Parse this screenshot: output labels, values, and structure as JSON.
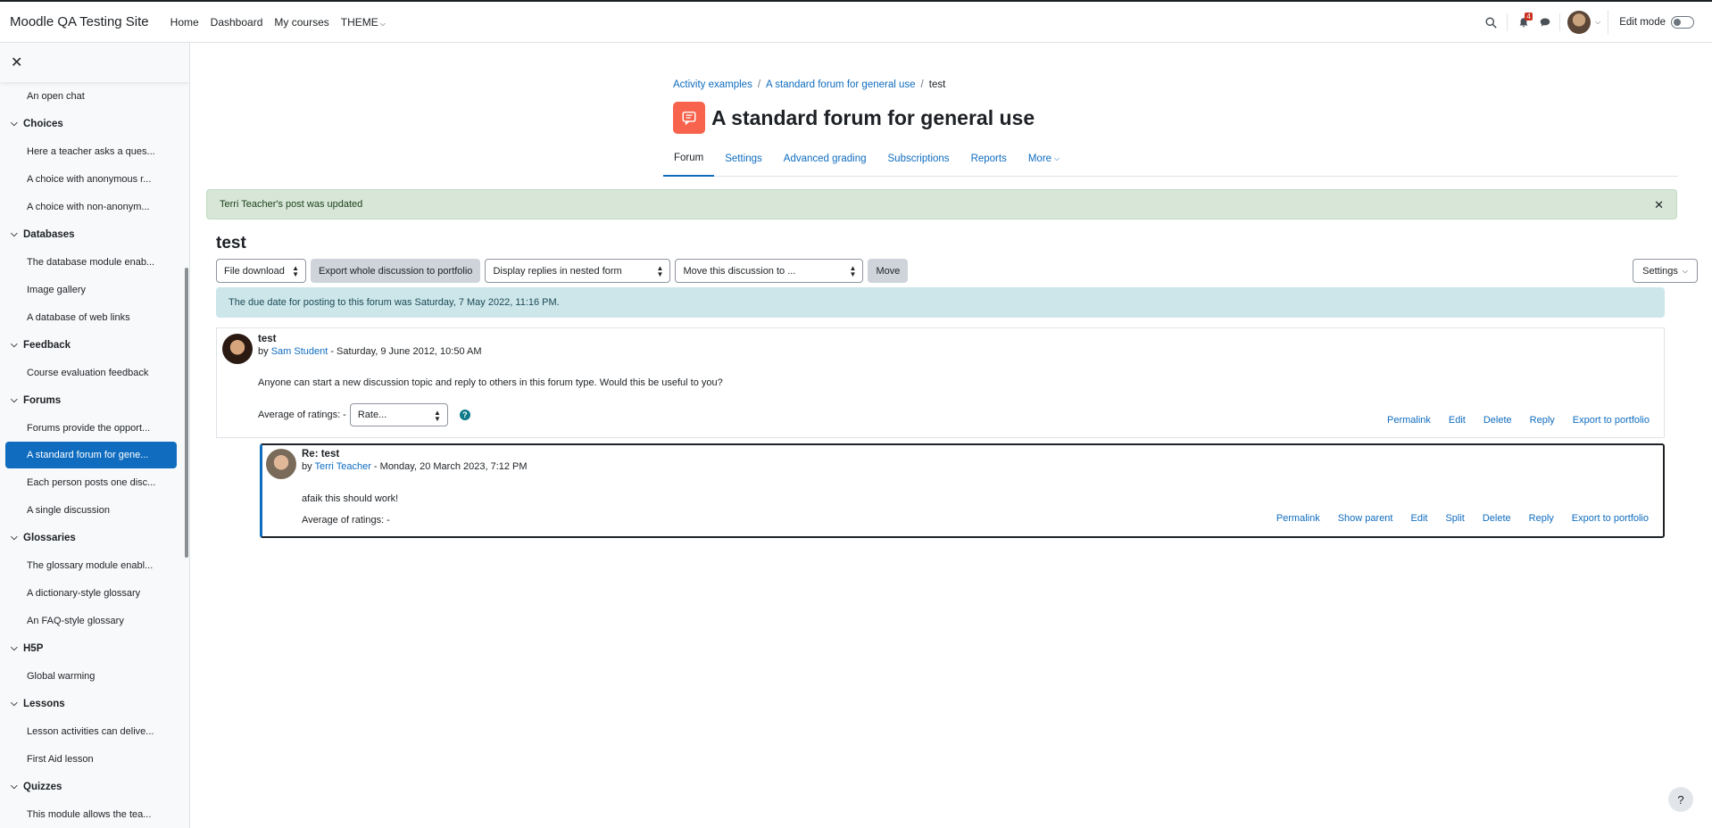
{
  "navbar": {
    "site_name": "Moodle QA Testing Site",
    "links": [
      "Home",
      "Dashboard",
      "My courses",
      "THEME"
    ],
    "notification_count": "4",
    "edit_mode_label": "Edit mode"
  },
  "drawer": {
    "items": [
      {
        "type": "item",
        "label": "An open chat"
      },
      {
        "type": "section",
        "label": "Choices"
      },
      {
        "type": "item",
        "label": "Here a teacher asks a ques..."
      },
      {
        "type": "item",
        "label": "A choice with anonymous r..."
      },
      {
        "type": "item",
        "label": "A choice with non-anonym..."
      },
      {
        "type": "section",
        "label": "Databases"
      },
      {
        "type": "item",
        "label": "The database module enab..."
      },
      {
        "type": "item",
        "label": "Image gallery"
      },
      {
        "type": "item",
        "label": "A database of web links"
      },
      {
        "type": "section",
        "label": "Feedback"
      },
      {
        "type": "item",
        "label": "Course evaluation feedback"
      },
      {
        "type": "section",
        "label": "Forums"
      },
      {
        "type": "item",
        "label": "Forums provide the opport..."
      },
      {
        "type": "item",
        "label": "A standard forum for gene...",
        "active": true
      },
      {
        "type": "item",
        "label": "Each person posts one disc..."
      },
      {
        "type": "item",
        "label": "A single discussion"
      },
      {
        "type": "section",
        "label": "Glossaries"
      },
      {
        "type": "item",
        "label": "The glossary module enabl..."
      },
      {
        "type": "item",
        "label": "A dictionary-style glossary"
      },
      {
        "type": "item",
        "label": "An FAQ-style glossary"
      },
      {
        "type": "section",
        "label": "H5P"
      },
      {
        "type": "item",
        "label": "Global warming"
      },
      {
        "type": "section",
        "label": "Lessons"
      },
      {
        "type": "item",
        "label": "Lesson activities can delive..."
      },
      {
        "type": "item",
        "label": "First Aid lesson"
      },
      {
        "type": "section",
        "label": "Quizzes"
      },
      {
        "type": "item",
        "label": "This module allows the tea..."
      }
    ]
  },
  "breadcrumb": [
    "Activity examples",
    "A standard forum for general use",
    "test"
  ],
  "page": {
    "title": "A standard forum for general use",
    "tabs": [
      {
        "label": "Forum",
        "active": true
      },
      {
        "label": "Settings"
      },
      {
        "label": "Advanced grading"
      },
      {
        "label": "Subscriptions"
      },
      {
        "label": "Reports"
      },
      {
        "label": "More"
      }
    ]
  },
  "alert_success": "Terri Teacher's post was updated",
  "discussion": {
    "title": "test",
    "toolbar": {
      "file_download": "File download",
      "export": "Export whole discussion to portfolio",
      "display_mode": "Display replies in nested form",
      "move_select": "Move this discussion to ...",
      "move_button": "Move",
      "settings": "Settings"
    },
    "due_notice": "The due date for posting to this forum was Saturday, 7 May 2022, 11:16 PM."
  },
  "posts": [
    {
      "subject": "test",
      "by": "by",
      "author": "Sam Student",
      "date": " - Saturday, 9 June 2012, 10:50 AM",
      "body": "Anyone can start a new discussion topic and reply to others in this forum type. Would this be useful to you?",
      "rating_label": "Average of ratings: -",
      "rate_placeholder": "Rate...",
      "actions": [
        "Permalink",
        "Edit",
        "Delete",
        "Reply",
        "Export to portfolio"
      ]
    },
    {
      "subject": "Re: test",
      "by": "by",
      "author": "Terri Teacher",
      "date": " - Monday, 20 March 2023, 7:12 PM",
      "body": "afaik this should work!",
      "rating_label": "Average of ratings: -",
      "actions": [
        "Permalink",
        "Show parent",
        "Edit",
        "Split",
        "Delete",
        "Reply",
        "Export to portfolio"
      ]
    }
  ],
  "colors": {
    "brand": "#0f6cbf",
    "forum_icon": "#f7634d",
    "success_bg": "#d7e6d7",
    "info_bg": "#cce6ea"
  }
}
